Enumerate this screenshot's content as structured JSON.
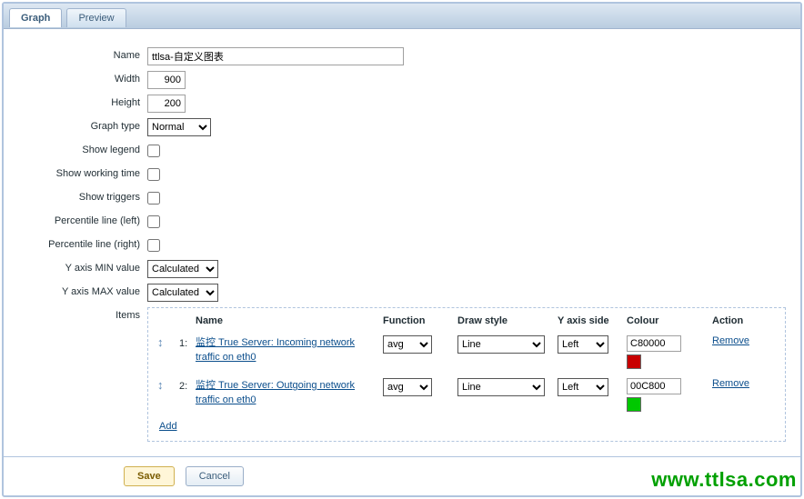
{
  "tabs": {
    "graph": "Graph",
    "preview": "Preview"
  },
  "labels": {
    "name": "Name",
    "width": "Width",
    "height": "Height",
    "graphType": "Graph type",
    "showLegend": "Show legend",
    "showWorking": "Show working time",
    "showTriggers": "Show triggers",
    "pctLeft": "Percentile line (left)",
    "pctRight": "Percentile line (right)",
    "yMin": "Y axis MIN value",
    "yMax": "Y axis MAX value",
    "items": "Items"
  },
  "values": {
    "name": "ttlsa-自定义图表",
    "width": "900",
    "height": "200",
    "graphType": "Normal",
    "yMin": "Calculated",
    "yMax": "Calculated"
  },
  "itemsTable": {
    "headers": {
      "name": "Name",
      "function": "Function",
      "drawStyle": "Draw style",
      "yAxis": "Y axis side",
      "colour": "Colour",
      "action": "Action"
    },
    "rows": [
      {
        "num": "1:",
        "link": "监控 True Server: Incoming network traffic on eth0",
        "func": "avg",
        "draw": "Line",
        "yaxis": "Left",
        "colour": "C80000",
        "swatch": "#C80000",
        "action": "Remove"
      },
      {
        "num": "2:",
        "link": "监控 True Server: Outgoing network traffic on eth0",
        "func": "avg",
        "draw": "Line",
        "yaxis": "Left",
        "colour": "00C800",
        "swatch": "#00C800",
        "action": "Remove"
      }
    ],
    "add": "Add"
  },
  "buttons": {
    "save": "Save",
    "cancel": "Cancel"
  },
  "watermark": "www.ttlsa.com"
}
